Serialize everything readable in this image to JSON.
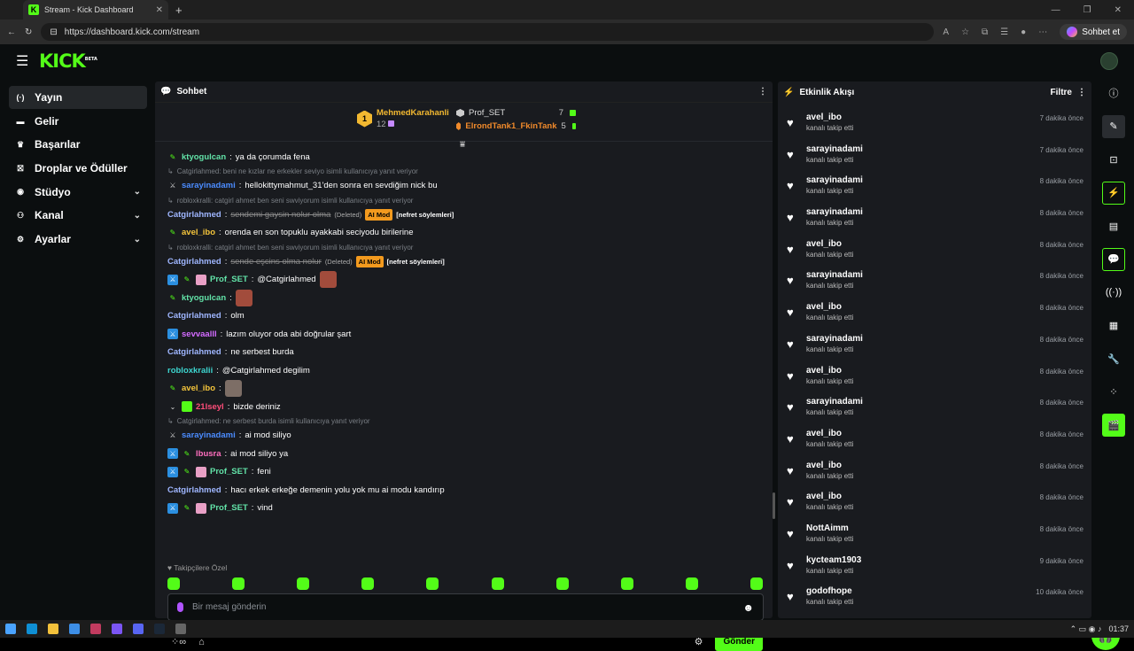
{
  "browser": {
    "tab_title": "Stream - Kick Dashboard",
    "url": "https://dashboard.kick.com/stream",
    "copilot_label": "Sohbet et"
  },
  "brand": {
    "logo": "KICK",
    "beta": "BETA"
  },
  "sidebar": {
    "items": [
      {
        "label": "Yayın",
        "icon": "broadcast-icon",
        "active": true
      },
      {
        "label": "Gelir",
        "icon": "revenue-icon"
      },
      {
        "label": "Başarılar",
        "icon": "trophy-icon"
      },
      {
        "label": "Droplar ve Ödüller",
        "icon": "gift-icon"
      },
      {
        "label": "Stüdyo",
        "icon": "studio-icon",
        "expandable": true
      },
      {
        "label": "Kanal",
        "icon": "channel-icon",
        "expandable": true
      },
      {
        "label": "Ayarlar",
        "icon": "gear-icon",
        "expandable": true
      }
    ]
  },
  "chat": {
    "title": "Sohbet",
    "leaderboard": {
      "top": {
        "rank": "1",
        "name": "MehmedKarahanli",
        "count": "12"
      },
      "others": [
        {
          "name": "Prof_SET",
          "count": "7"
        },
        {
          "name": "ElrondTank1_FkinTank",
          "count": "5"
        }
      ]
    },
    "messages": [
      {
        "reply": "",
        "user": "ktyogulcan",
        "text": "ya da çorumda fena"
      },
      {
        "reply": "Catgirlahmed: beni ne kızlar ne erkekler seviyo isimli kullanıcıya yanıt veriyor",
        "user": "sarayinadami",
        "text": "hellokittymahmut_31'den sonra en sevdiğim nick bu"
      },
      {
        "reply": "robloxkralli: catgirl ahmet ben seni swviyorum isimli kullanıcıya yanıt veriyor",
        "user": "Catgirlahmed",
        "text": "sendemi gaysin nolur olma",
        "deleted": "(Deleted)",
        "aimod": "AI Mod",
        "tag": "[nefret söylemleri]"
      },
      {
        "reply": "",
        "user": "avel_ibo",
        "text": "orenda en son topuklu ayakkabi seciyodu birilerine"
      },
      {
        "reply": "robloxkralli: catgirl ahmet ben seni swviyorum isimli kullanıcıya yanıt veriyor",
        "user": "Catgirlahmed",
        "text": "sende eşcins olma nolur",
        "deleted": "(Deleted)",
        "aimod": "AI Mod",
        "tag": "[nefret söylemleri]"
      },
      {
        "reply": "",
        "user": "Prof_SET",
        "text": "@Catgirlahmed"
      },
      {
        "reply": "",
        "user": "ktyogulcan",
        "text": ""
      },
      {
        "reply": "",
        "user": "Catgirlahmed",
        "text": "olm"
      },
      {
        "reply": "",
        "user": "sevvaalll",
        "text": "lazım oluyor oda abi doğrular şart"
      },
      {
        "reply": "",
        "user": "Catgirlahmed",
        "text": "ne serbest burda"
      },
      {
        "reply": "",
        "user": "robloxkralii",
        "text": "@Catgirlahmed degilim"
      },
      {
        "reply": "",
        "user": "avel_ibo",
        "text": ""
      },
      {
        "reply": "",
        "user": "21lseyl",
        "text": "bizde deriniz"
      },
      {
        "reply": "Catgirlahmed: ne serbest burda isimli kullanıcıya yanıt veriyor",
        "user": "sarayinadami",
        "text": "ai mod siliyo"
      },
      {
        "reply": "",
        "user": "lbusra",
        "text": "ai mod siliyo ya"
      },
      {
        "reply": "",
        "user": "Prof_SET",
        "text": "feni"
      },
      {
        "reply": "",
        "user": "Catgirlahmed",
        "text": "hacı erkek erkeğe demenin yolu yok mu ai modu kandırıp"
      },
      {
        "reply": "",
        "user": "Prof_SET",
        "text": "vind"
      }
    ],
    "followers_only": "Takipçilere Özel",
    "input_placeholder": "Bir mesaj gönderin",
    "send_label": "Gönder"
  },
  "activity": {
    "title": "Etkinlik Akışı",
    "filter_label": "Filtre",
    "items": [
      {
        "name": "avel_ibo",
        "action": "kanalı takip etti",
        "time": "7 dakika önce"
      },
      {
        "name": "sarayinadami",
        "action": "kanalı takip etti",
        "time": "7 dakika önce"
      },
      {
        "name": "sarayinadami",
        "action": "kanalı takip etti",
        "time": "8 dakika önce"
      },
      {
        "name": "sarayinadami",
        "action": "kanalı takip etti",
        "time": "8 dakika önce"
      },
      {
        "name": "avel_ibo",
        "action": "kanalı takip etti",
        "time": "8 dakika önce"
      },
      {
        "name": "sarayinadami",
        "action": "kanalı takip etti",
        "time": "8 dakika önce"
      },
      {
        "name": "avel_ibo",
        "action": "kanalı takip etti",
        "time": "8 dakika önce"
      },
      {
        "name": "sarayinadami",
        "action": "kanalı takip etti",
        "time": "8 dakika önce"
      },
      {
        "name": "avel_ibo",
        "action": "kanalı takip etti",
        "time": "8 dakika önce"
      },
      {
        "name": "sarayinadami",
        "action": "kanalı takip etti",
        "time": "8 dakika önce"
      },
      {
        "name": "avel_ibo",
        "action": "kanalı takip etti",
        "time": "8 dakika önce"
      },
      {
        "name": "avel_ibo",
        "action": "kanalı takip etti",
        "time": "8 dakika önce"
      },
      {
        "name": "avel_ibo",
        "action": "kanalı takip etti",
        "time": "8 dakika önce"
      },
      {
        "name": "NottAimm",
        "action": "kanalı takip etti",
        "time": "8 dakika önce"
      },
      {
        "name": "kycteam1903",
        "action": "kanalı takip etti",
        "time": "9 dakika önce"
      },
      {
        "name": "godofhope",
        "action": "kanalı takip etti",
        "time": "10 dakika önce"
      }
    ]
  },
  "taskbar": {
    "time": "01:37"
  },
  "colors": {
    "accent": "#53fc18",
    "panel": "#191b1f",
    "background": "#0b0e0f"
  }
}
